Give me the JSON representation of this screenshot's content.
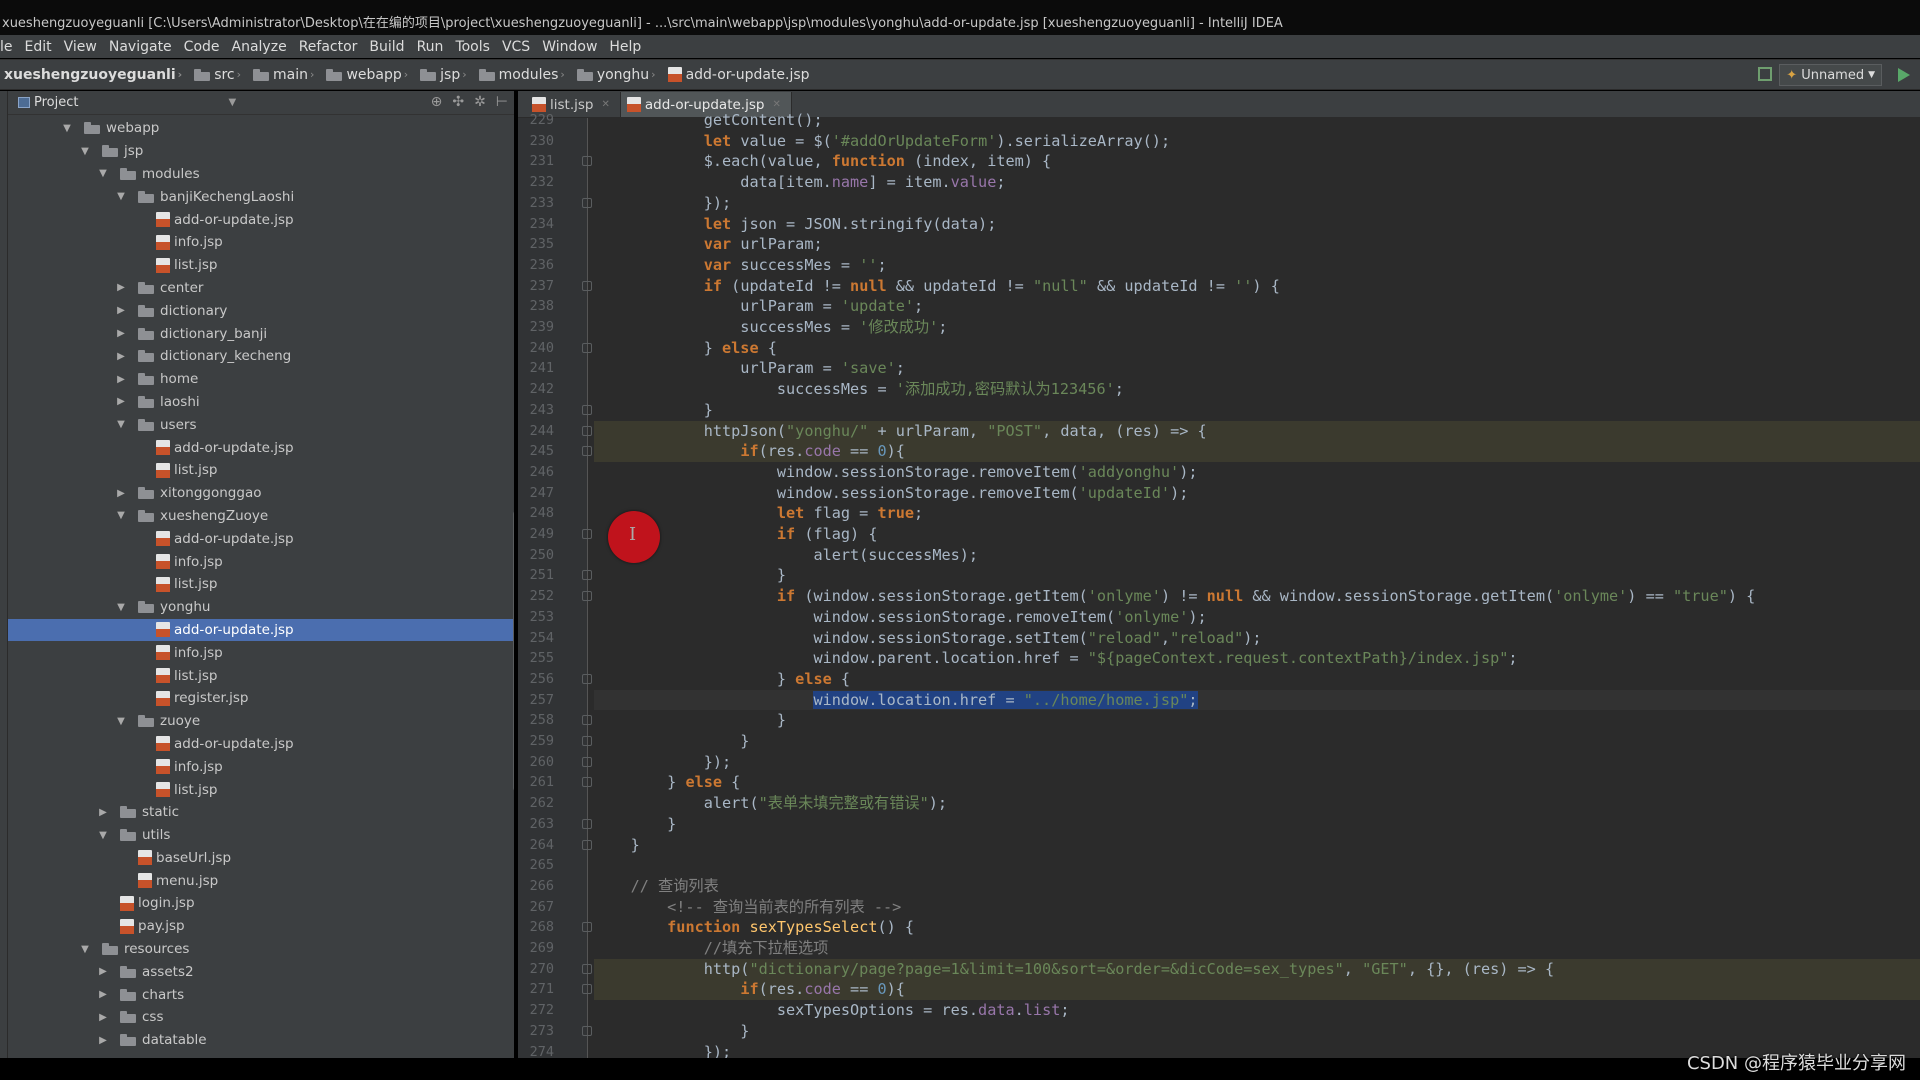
{
  "titlebar": "xueshengzuoyeguanli [C:\\Users\\Administrator\\Desktop\\在在编的项目\\project\\xueshengzuoyeguanli] - ...\\src\\main\\webapp\\jsp\\modules\\yonghu\\add-or-update.jsp [xueshengzuoyeguanli] - IntelliJ IDEA",
  "menu": [
    "le",
    "Edit",
    "View",
    "Navigate",
    "Code",
    "Analyze",
    "Refactor",
    "Build",
    "Run",
    "Tools",
    "VCS",
    "Window",
    "Help"
  ],
  "breadcrumbs": [
    "xueshengzuoyeguanli",
    "src",
    "main",
    "webapp",
    "jsp",
    "modules",
    "yonghu",
    "add-or-update.jsp"
  ],
  "run_config": "Unnamed",
  "project_panel": {
    "title": "Project"
  },
  "tree": [
    {
      "label": "webapp",
      "type": "folder",
      "depth": 3,
      "expanded": true
    },
    {
      "label": "jsp",
      "type": "folder",
      "depth": 4,
      "expanded": true
    },
    {
      "label": "modules",
      "type": "folder",
      "depth": 5,
      "expanded": true
    },
    {
      "label": "banjiKechengLaoshi",
      "type": "folder",
      "depth": 6,
      "expanded": true
    },
    {
      "label": "add-or-update.jsp",
      "type": "jsp",
      "depth": 7
    },
    {
      "label": "info.jsp",
      "type": "jsp",
      "depth": 7
    },
    {
      "label": "list.jsp",
      "type": "jsp",
      "depth": 7
    },
    {
      "label": "center",
      "type": "folder",
      "depth": 6,
      "expanded": false
    },
    {
      "label": "dictionary",
      "type": "folder",
      "depth": 6,
      "expanded": false
    },
    {
      "label": "dictionary_banji",
      "type": "folder",
      "depth": 6,
      "expanded": false
    },
    {
      "label": "dictionary_kecheng",
      "type": "folder",
      "depth": 6,
      "expanded": false
    },
    {
      "label": "home",
      "type": "folder",
      "depth": 6,
      "expanded": false
    },
    {
      "label": "laoshi",
      "type": "folder",
      "depth": 6,
      "expanded": false
    },
    {
      "label": "users",
      "type": "folder",
      "depth": 6,
      "expanded": true
    },
    {
      "label": "add-or-update.jsp",
      "type": "jsp",
      "depth": 7
    },
    {
      "label": "list.jsp",
      "type": "jsp",
      "depth": 7
    },
    {
      "label": "xitonggonggao",
      "type": "folder",
      "depth": 6,
      "expanded": false
    },
    {
      "label": "xueshengZuoye",
      "type": "folder",
      "depth": 6,
      "expanded": true
    },
    {
      "label": "add-or-update.jsp",
      "type": "jsp",
      "depth": 7
    },
    {
      "label": "info.jsp",
      "type": "jsp",
      "depth": 7
    },
    {
      "label": "list.jsp",
      "type": "jsp",
      "depth": 7
    },
    {
      "label": "yonghu",
      "type": "folder",
      "depth": 6,
      "expanded": true
    },
    {
      "label": "add-or-update.jsp",
      "type": "jsp",
      "depth": 7,
      "selected": true
    },
    {
      "label": "info.jsp",
      "type": "jsp",
      "depth": 7
    },
    {
      "label": "list.jsp",
      "type": "jsp",
      "depth": 7
    },
    {
      "label": "register.jsp",
      "type": "jsp",
      "depth": 7
    },
    {
      "label": "zuoye",
      "type": "folder",
      "depth": 6,
      "expanded": true
    },
    {
      "label": "add-or-update.jsp",
      "type": "jsp",
      "depth": 7
    },
    {
      "label": "info.jsp",
      "type": "jsp",
      "depth": 7
    },
    {
      "label": "list.jsp",
      "type": "jsp",
      "depth": 7
    },
    {
      "label": "static",
      "type": "folder",
      "depth": 5,
      "expanded": false
    },
    {
      "label": "utils",
      "type": "folder",
      "depth": 5,
      "expanded": true
    },
    {
      "label": "baseUrl.jsp",
      "type": "jsp",
      "depth": 6
    },
    {
      "label": "menu.jsp",
      "type": "jsp",
      "depth": 6
    },
    {
      "label": "login.jsp",
      "type": "jsp",
      "depth": 5
    },
    {
      "label": "pay.jsp",
      "type": "jsp",
      "depth": 5
    },
    {
      "label": "resources",
      "type": "folder",
      "depth": 4,
      "expanded": true
    },
    {
      "label": "assets2",
      "type": "folder",
      "depth": 5,
      "expanded": false
    },
    {
      "label": "charts",
      "type": "folder",
      "depth": 5,
      "expanded": false
    },
    {
      "label": "css",
      "type": "folder",
      "depth": 5,
      "expanded": false
    },
    {
      "label": "datatable",
      "type": "folder",
      "depth": 5,
      "expanded": false
    }
  ],
  "tabs": [
    {
      "label": "list.jsp",
      "active": false
    },
    {
      "label": "add-or-update.jsp",
      "active": true
    }
  ],
  "code_lines": [
    {
      "n": 229,
      "text": "            getContent();"
    },
    {
      "n": 230,
      "text": "            let value = $('#addOrUpdateForm').serializeArray();"
    },
    {
      "n": 231,
      "text": "            $.each(value, function (index, item) {"
    },
    {
      "n": 232,
      "text": "                data[item.name] = item.value;"
    },
    {
      "n": 233,
      "text": "            });"
    },
    {
      "n": 234,
      "text": "            let json = JSON.stringify(data);"
    },
    {
      "n": 235,
      "text": "            var urlParam;"
    },
    {
      "n": 236,
      "text": "            var successMes = '';"
    },
    {
      "n": 237,
      "text": "            if (updateId != null && updateId != \"null\" && updateId != '') {"
    },
    {
      "n": 238,
      "text": "                urlParam = 'update';"
    },
    {
      "n": 239,
      "text": "                successMes = '修改成功';"
    },
    {
      "n": 240,
      "text": "            } else {"
    },
    {
      "n": 241,
      "text": "                urlParam = 'save';"
    },
    {
      "n": 242,
      "text": "                    successMes = '添加成功,密码默认为123456';"
    },
    {
      "n": 243,
      "text": "            }"
    },
    {
      "n": 244,
      "text": "            httpJson(\"yonghu/\" + urlParam, \"POST\", data, (res) => {"
    },
    {
      "n": 245,
      "text": "                if(res.code == 0){"
    },
    {
      "n": 246,
      "text": "                    window.sessionStorage.removeItem('addyonghu');"
    },
    {
      "n": 247,
      "text": "                    window.sessionStorage.removeItem('updateId');"
    },
    {
      "n": 248,
      "text": "                    let flag = true;"
    },
    {
      "n": 249,
      "text": "                    if (flag) {"
    },
    {
      "n": 250,
      "text": "                        alert(successMes);"
    },
    {
      "n": 251,
      "text": "                    }"
    },
    {
      "n": 252,
      "text": "                    if (window.sessionStorage.getItem('onlyme') != null && window.sessionStorage.getItem('onlyme') == \"true\") {"
    },
    {
      "n": 253,
      "text": "                        window.sessionStorage.removeItem('onlyme');"
    },
    {
      "n": 254,
      "text": "                        window.sessionStorage.setItem(\"reload\",\"reload\");"
    },
    {
      "n": 255,
      "text": "                        window.parent.location.href = \"${pageContext.request.contextPath}/index.jsp\";"
    },
    {
      "n": 256,
      "text": "                    } else {"
    },
    {
      "n": 257,
      "text": "                        window.location.href = \"../home/home.jsp\";"
    },
    {
      "n": 258,
      "text": "                    }"
    },
    {
      "n": 259,
      "text": "                }"
    },
    {
      "n": 260,
      "text": "            });"
    },
    {
      "n": 261,
      "text": "        } else {"
    },
    {
      "n": 262,
      "text": "            alert(\"表单未填完整或有错误\");"
    },
    {
      "n": 263,
      "text": "        }"
    },
    {
      "n": 264,
      "text": "    }"
    },
    {
      "n": 265,
      "text": ""
    },
    {
      "n": 266,
      "text": "    // 查询列表"
    },
    {
      "n": 267,
      "text": "        <!-- 查询当前表的所有列表 -->"
    },
    {
      "n": 268,
      "text": "        function sexTypesSelect() {"
    },
    {
      "n": 269,
      "text": "            //填充下拉框选项"
    },
    {
      "n": 270,
      "text": "            http(\"dictionary/page?page=1&limit=100&sort=&order=&dicCode=sex_types\", \"GET\", {}, (res) => {"
    },
    {
      "n": 271,
      "text": "                if(res.code == 0){"
    },
    {
      "n": 272,
      "text": "                    sexTypesOptions = res.data.list;"
    },
    {
      "n": 273,
      "text": "                }"
    },
    {
      "n": 274,
      "text": "            });"
    }
  ],
  "watermark": "CSDN @程序猿毕业分享网"
}
